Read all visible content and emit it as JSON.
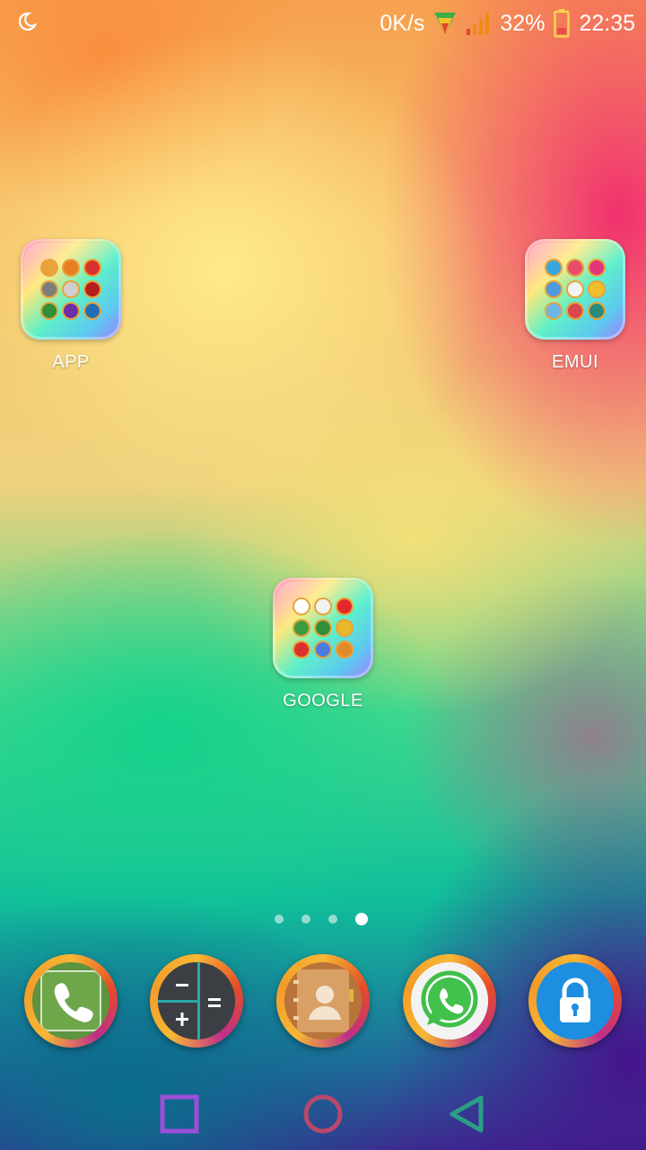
{
  "status_bar": {
    "night_mode_icon": "moon-icon",
    "net_speed": "0K/s",
    "battery_percent": "32%",
    "time": "22:35"
  },
  "folders": [
    {
      "label": "APP",
      "icon": "folder-icon",
      "mini_icons": [
        "chrome",
        "vlc",
        "opera",
        "settings",
        "printer",
        "acrobat",
        "camera",
        "m",
        "linkedin"
      ]
    },
    {
      "label": "EMUI",
      "icon": "folder-icon",
      "mini_icons": [
        "weather",
        "music",
        "themes",
        "display",
        "clock",
        "notes",
        "gallery",
        "health",
        "emui"
      ]
    },
    {
      "label": "GOOGLE",
      "icon": "folder-icon",
      "mini_icons": [
        "google",
        "chrome",
        "youtube",
        "maps",
        "gallery",
        "drive",
        "record",
        "translate",
        "headphones"
      ]
    }
  ],
  "page_indicator": {
    "count": 4,
    "active": 4
  },
  "dock": [
    {
      "name": "phone-app",
      "icon": "phone-icon"
    },
    {
      "name": "calculator-app",
      "icon": "calculator-icon"
    },
    {
      "name": "contacts-app",
      "icon": "contacts-icon"
    },
    {
      "name": "whatsapp-app",
      "icon": "whatsapp-icon"
    },
    {
      "name": "lock-app",
      "icon": "lock-icon"
    }
  ],
  "nav_bar": {
    "recent": "square-icon",
    "home": "circle-icon",
    "back": "triangle-icon"
  },
  "colors": {
    "nav_recent": "#9b4fd6",
    "nav_home": "#b9486b",
    "nav_back": "#2a9f86",
    "battery_fill": "#e94a4a",
    "signal": "#ef8a17"
  }
}
